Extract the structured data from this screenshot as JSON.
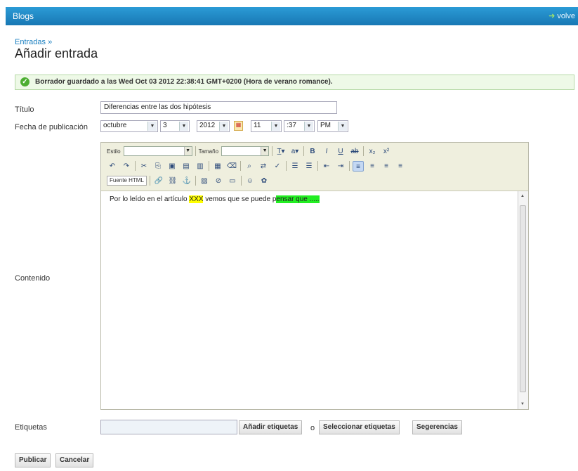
{
  "header": {
    "left": "Blogs",
    "right": "volve",
    "right_arrow": "➜"
  },
  "breadcrumb": "Entradas »",
  "page_title": "Añadir entrada",
  "notice": "Borrador guardado a las Wed Oct 03 2012 22:38:41 GMT+0200 (Hora de verano romance).",
  "form": {
    "titulo_label": "Título",
    "titulo_value": "Diferencias entre las dos hipótesis",
    "fecha_label": "Fecha de publicación",
    "month": "octubre",
    "day": "3",
    "year": "2012",
    "hour": "11",
    "minute": ":37",
    "ampm": "PM",
    "contenido_label": "Contenido",
    "etiquetas_label": "Etiquetas",
    "o": "o"
  },
  "toolbar": {
    "estilo": "Estilo",
    "tamano": "Tamaño",
    "bold": "B",
    "italic": "I",
    "underline": "U",
    "fuente_html": "Fuente HTML"
  },
  "content": {
    "part1": "Por lo leído en el artículo ",
    "part2": "XXX",
    "part3": " vemos que se puede p",
    "part4": "ensar que ....."
  },
  "buttons": {
    "add_tags": "Añadir etiquetas",
    "select_tags": "Seleccionar etiquetas",
    "suggestions": "Segerencias",
    "publish": "Publicar",
    "cancel": "Cancelar"
  }
}
